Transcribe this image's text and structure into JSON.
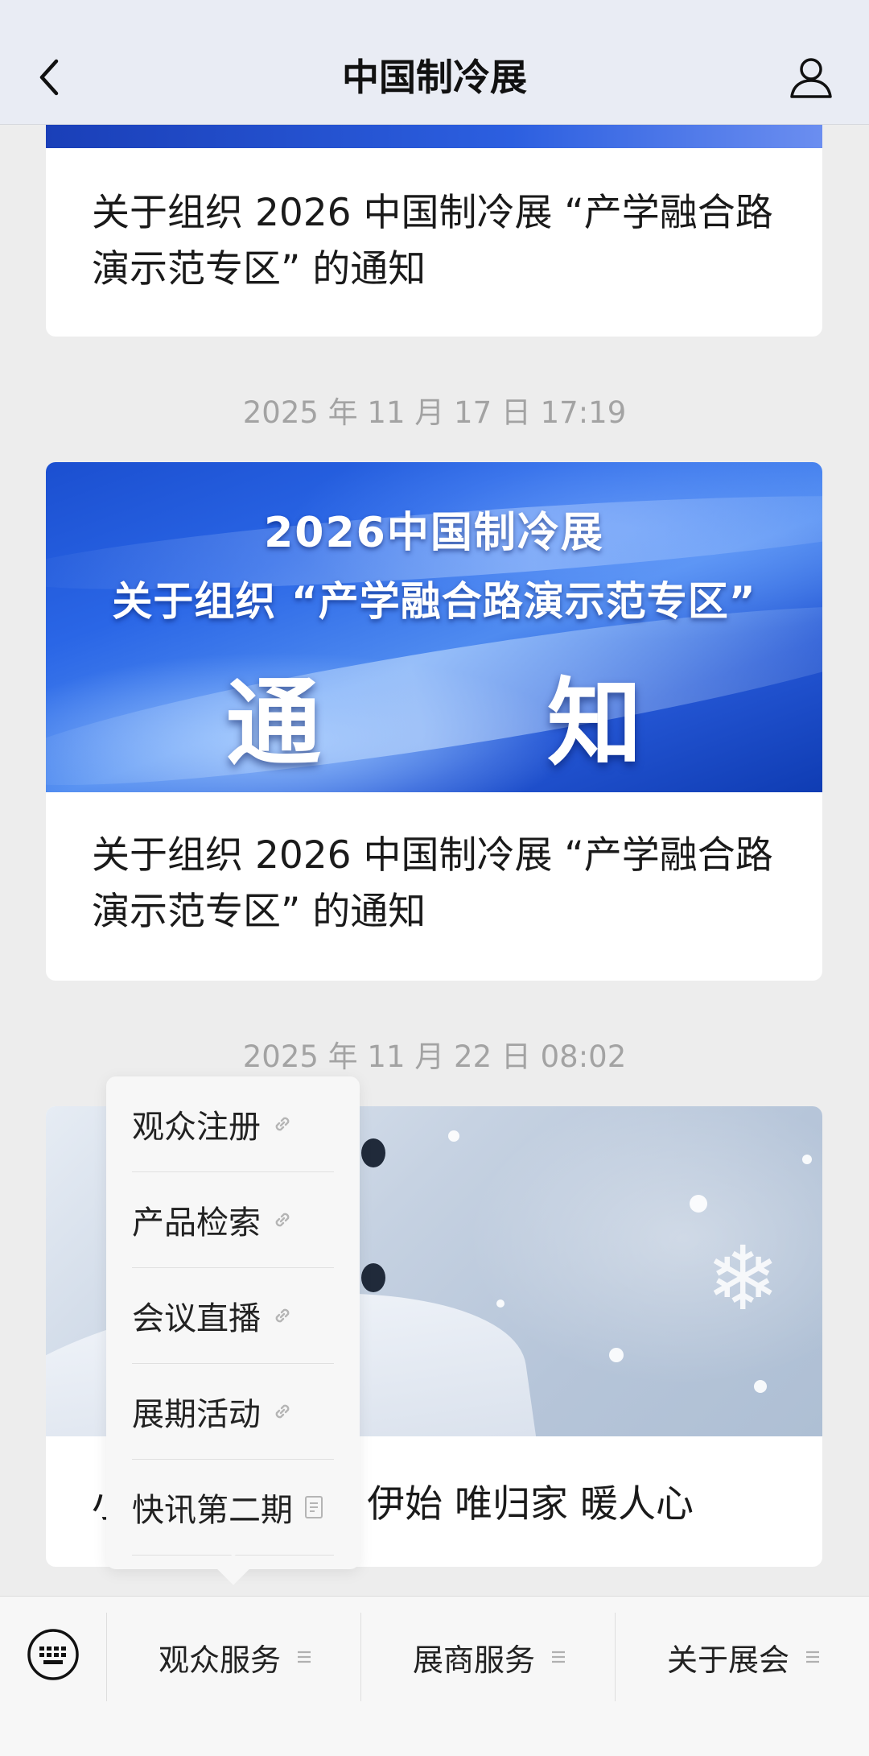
{
  "header": {
    "title": "中国制冷展",
    "back_icon": "chevron-left-icon",
    "user_icon": "user-icon"
  },
  "feed": {
    "cards": [
      {
        "title_line1": "关于组织 2026 中国制冷展 “产学融合路",
        "title_line2": "演示范专区” 的通知"
      },
      {
        "timestamp": "2025 年 11 月 17 日 17:19",
        "banner": {
          "line1": "2026中国制冷展",
          "line2": "关于组织 “产学融合路演示范专区”",
          "line3": "通 知"
        },
        "title_line1": "关于组织 2026 中国制冷展 “产学融合路",
        "title_line2": "演示范专区” 的通知"
      },
      {
        "timestamp": "2025 年 11 月 22 日 08:02",
        "title_visible_prefix": "小",
        "title_visible": "伊始 唯归家 暖人心"
      }
    ]
  },
  "popup_menu": {
    "items": [
      {
        "label": "观众注册",
        "icon": "link-icon"
      },
      {
        "label": "产品检索",
        "icon": "link-icon"
      },
      {
        "label": "会议直播",
        "icon": "link-icon"
      },
      {
        "label": "展期活动",
        "icon": "link-icon"
      },
      {
        "label": "快讯第二期",
        "icon": "article-icon"
      }
    ]
  },
  "bottom_bar": {
    "keyboard_icon": "keyboard-icon",
    "tabs": [
      {
        "label": "观众服务",
        "icon": "menu-lines-icon"
      },
      {
        "label": "展商服务",
        "icon": "menu-lines-icon"
      },
      {
        "label": "关于展会",
        "icon": "menu-lines-icon"
      }
    ]
  }
}
